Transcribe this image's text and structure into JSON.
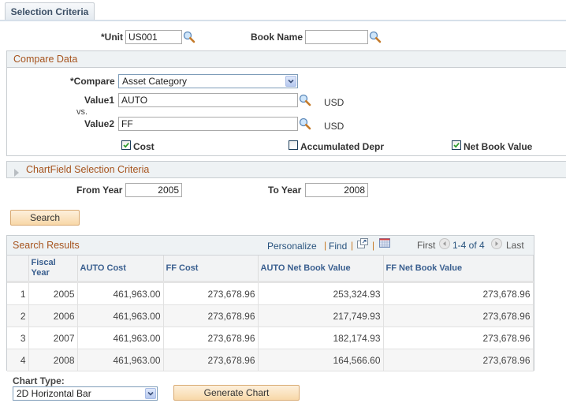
{
  "tabs": [
    {
      "label": "Selection Criteria",
      "active": true
    }
  ],
  "criteria": {
    "unit_label": "*Unit",
    "unit_value": "US001",
    "book_name_label": "Book Name",
    "book_name_value": ""
  },
  "compare_data": {
    "title": "Compare Data",
    "compare_label": "*Compare",
    "compare_value": "Asset Category",
    "value1_label": "Value1",
    "value1": "AUTO",
    "value1_currency": "USD",
    "vs_label": "vs.",
    "value2_label": "Value2",
    "value2": "FF",
    "value2_currency": "USD",
    "checkboxes": [
      {
        "label": "Cost",
        "checked": true
      },
      {
        "label": "Accumulated Depr",
        "checked": false
      },
      {
        "label": "Net Book Value",
        "checked": true
      }
    ]
  },
  "chartfield": {
    "title": "ChartField Selection Criteria",
    "collapsed": true
  },
  "years": {
    "from_label": "From Year",
    "from_value": "2005",
    "to_label": "To Year",
    "to_value": "2008"
  },
  "search_button": "Search",
  "results": {
    "title": "Search Results",
    "personalize": "Personalize",
    "find": "Find",
    "first": "First",
    "range": "1-4 of 4",
    "last": "Last",
    "columns": [
      "",
      "Fiscal Year",
      "AUTO Cost",
      "FF Cost",
      "AUTO Net Book Value",
      "FF Net Book Value"
    ],
    "rows": [
      {
        "num": "1",
        "year": "2005",
        "auto_cost": "461,963.00",
        "ff_cost": "273,678.96",
        "auto_nbv": "253,324.93",
        "ff_nbv": "273,678.96"
      },
      {
        "num": "2",
        "year": "2006",
        "auto_cost": "461,963.00",
        "ff_cost": "273,678.96",
        "auto_nbv": "217,749.93",
        "ff_nbv": "273,678.96"
      },
      {
        "num": "3",
        "year": "2007",
        "auto_cost": "461,963.00",
        "ff_cost": "273,678.96",
        "auto_nbv": "182,174.93",
        "ff_nbv": "273,678.96"
      },
      {
        "num": "4",
        "year": "2008",
        "auto_cost": "461,963.00",
        "ff_cost": "273,678.96",
        "auto_nbv": "164,566.60",
        "ff_nbv": "273,678.96"
      }
    ]
  },
  "chart": {
    "type_label": "Chart Type:",
    "type_value": "2D Horizontal Bar",
    "generate_button": "Generate Chart"
  },
  "colors": {
    "section_title": "#a6541e",
    "link": "#28537e",
    "header_text": "#3a5f8f",
    "check_green": "#2a9a2a"
  }
}
